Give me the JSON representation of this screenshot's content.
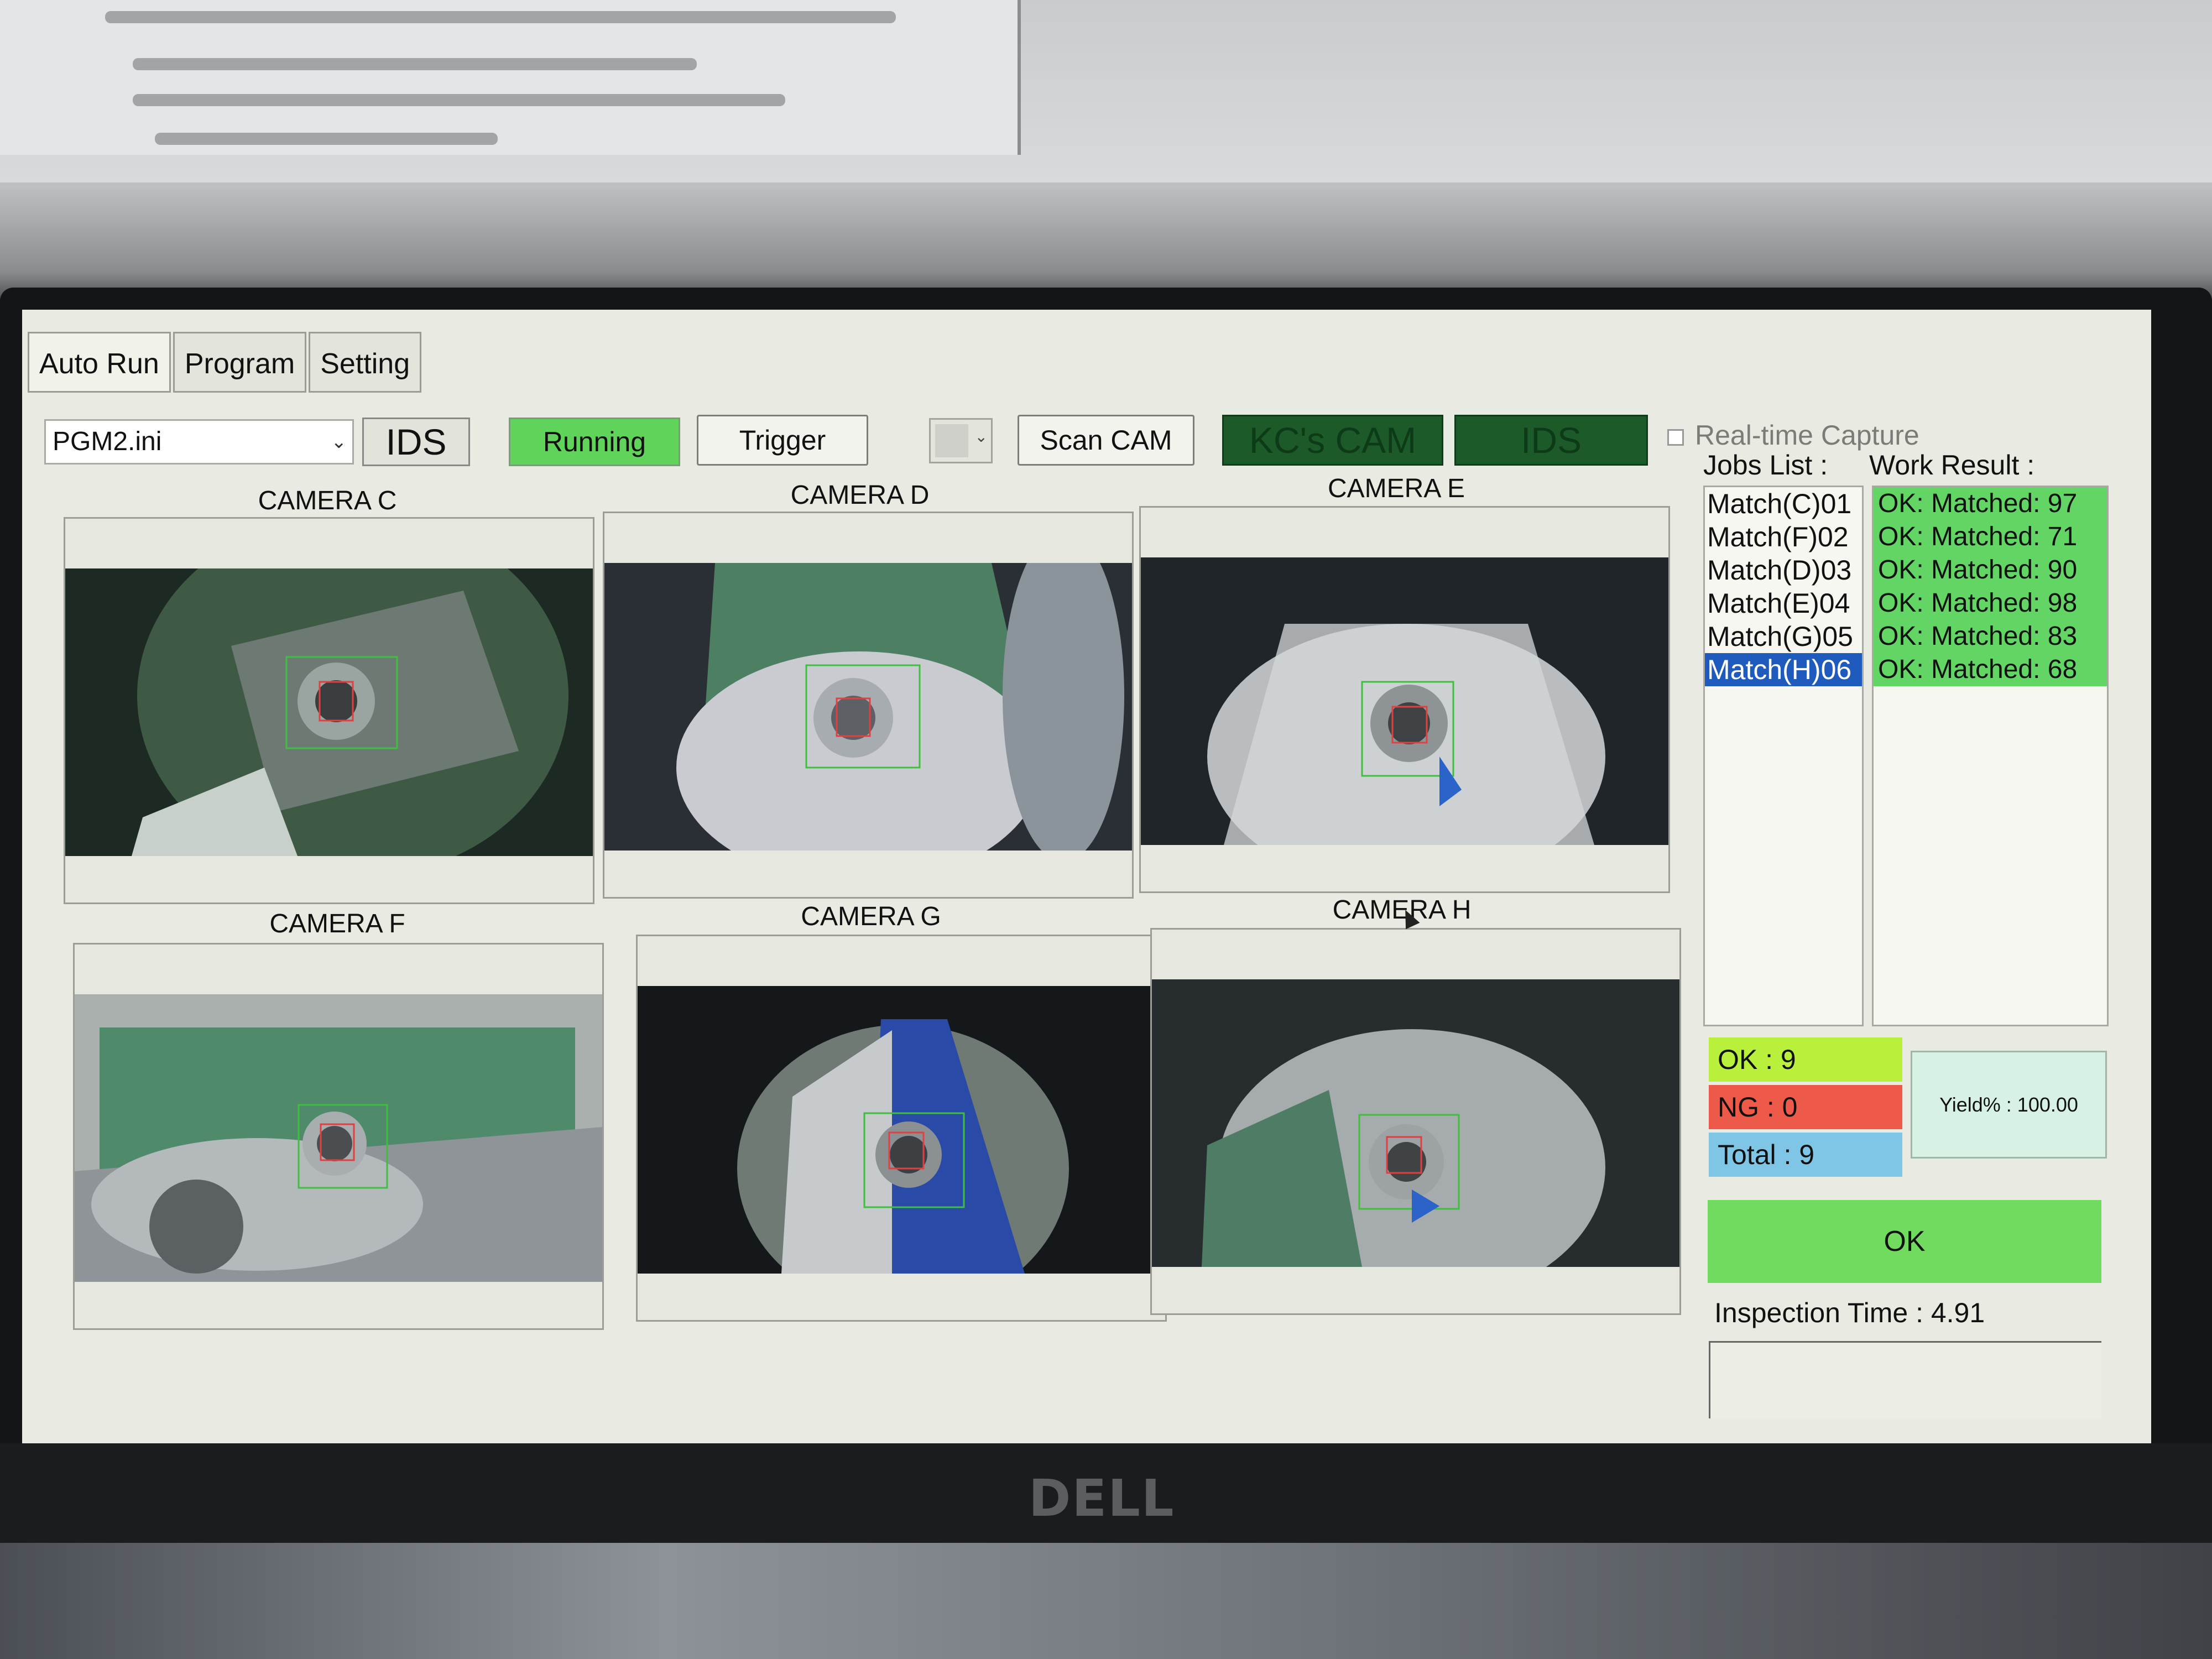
{
  "app": {
    "tabs": [
      "Auto Run",
      "Program",
      "Setting"
    ],
    "active_tab": "Auto Run"
  },
  "toolbar": {
    "program_file": "PGM2.ini",
    "ids_label": "IDS",
    "running_label": "Running",
    "trigger_label": "Trigger",
    "scan_cam_label": "Scan CAM",
    "kc_cam_label": "KC's CAM",
    "ids_status_label": "IDS",
    "realtime_capture_label": "Real-time Capture",
    "realtime_capture_checked": false,
    "running_color": "#5fd35a",
    "status_dark_green": "#1c5a2a"
  },
  "cameras": [
    {
      "label": "CAMERA C"
    },
    {
      "label": "CAMERA D"
    },
    {
      "label": "CAMERA E"
    },
    {
      "label": "CAMERA F"
    },
    {
      "label": "CAMERA G"
    },
    {
      "label": "CAMERA H"
    }
  ],
  "jobs": {
    "header": "Jobs List :",
    "items": [
      "Match(C)01",
      "Match(F)02",
      "Match(D)03",
      "Match(E)04",
      "Match(G)05",
      "Match(H)06"
    ],
    "selected_index": 5
  },
  "work_result": {
    "header": "Work Result :",
    "items": [
      "OK:  Matched: 97",
      "OK:  Matched: 71",
      "OK:  Matched: 90",
      "OK:  Matched: 98",
      "OK:  Matched: 83",
      "OK:  Matched: 68"
    ],
    "ok_color": "#62d565"
  },
  "counters": {
    "ok": "OK : 9",
    "ng": "NG : 0",
    "total": "Total : 9",
    "yield": "Yield% : 100.00"
  },
  "result": {
    "label": "OK",
    "color": "#70db5f"
  },
  "inspection_time": "Inspection Time : 4.91",
  "monitor_brand": "DELL"
}
